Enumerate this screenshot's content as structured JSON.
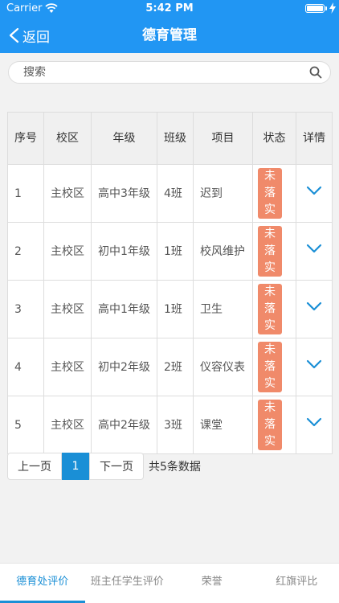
{
  "status_bar": {
    "carrier": "Carrier",
    "time": "5:42 PM",
    "battery_level": 1.0
  },
  "nav": {
    "back_label": "返回",
    "title": "德育管理"
  },
  "search": {
    "placeholder": "搜索"
  },
  "table": {
    "headers": [
      "序号",
      "校区",
      "年级",
      "班级",
      "项目",
      "状态",
      "详情"
    ],
    "rows": [
      {
        "index": "1",
        "campus": "主校区",
        "grade": "高中3年级",
        "class": "4班",
        "item": "迟到",
        "status": "未落实"
      },
      {
        "index": "2",
        "campus": "主校区",
        "grade": "初中1年级",
        "class": "1班",
        "item": "校风维护",
        "status": "未落实"
      },
      {
        "index": "3",
        "campus": "主校区",
        "grade": "高中1年级",
        "class": "1班",
        "item": "卫生",
        "status": "未落实"
      },
      {
        "index": "4",
        "campus": "主校区",
        "grade": "初中2年级",
        "class": "2班",
        "item": "仪容仪表",
        "status": "未落实"
      },
      {
        "index": "5",
        "campus": "主校区",
        "grade": "高中2年级",
        "class": "3班",
        "item": "课堂",
        "status": "未落实"
      }
    ]
  },
  "pagination": {
    "prev": "上一页",
    "page": "1",
    "next": "下一页",
    "total": "共5条数据"
  },
  "tabs": [
    {
      "label": "德育处评价",
      "active": true
    },
    {
      "label": "班主任学生评价",
      "active": false
    },
    {
      "label": "荣誉",
      "active": false
    },
    {
      "label": "红旗评比",
      "active": false
    }
  ],
  "colors": {
    "primary": "#2196f3",
    "accent": "#1a8fd6",
    "badge": "#f08a6a"
  }
}
